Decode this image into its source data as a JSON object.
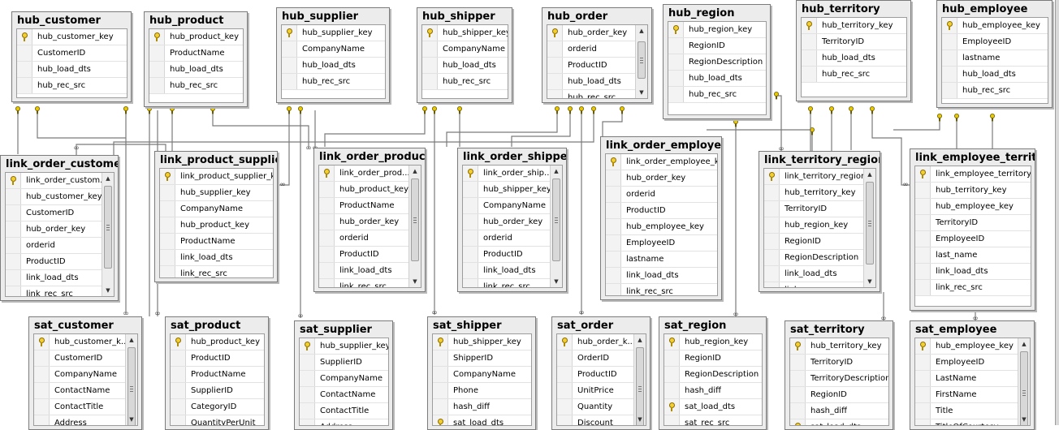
{
  "tables": [
    {
      "id": "hub_customer",
      "title": "hub_customer",
      "key": "hub_customer_key",
      "fields": [
        "CustomerID",
        "hub_load_dts",
        "hub_rec_src"
      ]
    },
    {
      "id": "hub_product",
      "title": "hub_product",
      "key": "hub_product_key",
      "fields": [
        "ProductName",
        "hub_load_dts",
        "hub_rec_src"
      ]
    },
    {
      "id": "hub_supplier",
      "title": "hub_supplier",
      "key": "hub_supplier_key",
      "fields": [
        "CompanyName",
        "hub_load_dts",
        "hub_rec_src"
      ]
    },
    {
      "id": "hub_shipper",
      "title": "hub_shipper",
      "key": "hub_shipper_key",
      "fields": [
        "CompanyName",
        "hub_load_dts",
        "hub_rec_src"
      ]
    },
    {
      "id": "hub_order",
      "title": "hub_order",
      "key": "hub_order_key",
      "fields": [
        "orderid",
        "ProductID",
        "hub_load_dts",
        "hub_rec_src"
      ]
    },
    {
      "id": "hub_region",
      "title": "hub_region",
      "key": "hub_region_key",
      "fields": [
        "RegionID",
        "RegionDescription",
        "hub_load_dts",
        "hub_rec_src"
      ]
    },
    {
      "id": "hub_territory",
      "title": "hub_territory",
      "key": "hub_territory_key",
      "fields": [
        "TerritoryID",
        "hub_load_dts",
        "hub_rec_src"
      ]
    },
    {
      "id": "hub_employee",
      "title": "hub_employee",
      "key": "hub_employee_key",
      "fields": [
        "EmployeeID",
        "lastname",
        "hub_load_dts",
        "hub_rec_src"
      ]
    },
    {
      "id": "link_order_customer",
      "title": "link_order_customer",
      "key": "link_order_custom...",
      "fields": [
        "hub_customer_key",
        "CustomerID",
        "hub_order_key",
        "orderid",
        "ProductID",
        "link_load_dts",
        "link_rec_src"
      ]
    },
    {
      "id": "link_product_supplier",
      "title": "link_product_supplier",
      "key": "link_product_supplier_k...",
      "fields": [
        "hub_supplier_key",
        "CompanyName",
        "hub_product_key",
        "ProductName",
        "link_load_dts",
        "link_rec_src"
      ]
    },
    {
      "id": "link_order_product",
      "title": "link_order_product",
      "key": "link_order_prod...",
      "fields": [
        "hub_product_key",
        "ProductName",
        "hub_order_key",
        "orderid",
        "ProductID",
        "link_load_dts",
        "link_rec_src"
      ]
    },
    {
      "id": "link_order_shipper",
      "title": "link_order_shipper",
      "key": "link_order_ship...",
      "fields": [
        "hub_shipper_key",
        "CompanyName",
        "hub_order_key",
        "orderid",
        "ProductID",
        "link_load_dts",
        "link_rec_src"
      ]
    },
    {
      "id": "link_order_employee",
      "title": "link_order_employee",
      "key": "link_order_employee_key",
      "fields": [
        "hub_order_key",
        "orderid",
        "ProductID",
        "hub_employee_key",
        "EmployeeID",
        "lastname",
        "link_load_dts",
        "link_rec_src"
      ]
    },
    {
      "id": "link_territory_region",
      "title": "link_territory_region",
      "key": "link_territory_region...",
      "fields": [
        "hub_territory_key",
        "TerritoryID",
        "hub_region_key",
        "RegionID",
        "RegionDescription",
        "link_load_dts",
        "link_rec_src"
      ]
    },
    {
      "id": "link_employee_territory",
      "title": "link_employee_territory",
      "key": "link_employee_territory_...",
      "fields": [
        "hub_territory_key",
        "hub_employee_key",
        "TerritoryID",
        "EmployeeID",
        "last_name",
        "link_load_dts",
        "link_rec_src"
      ]
    },
    {
      "id": "sat_customer",
      "title": "sat_customer",
      "key": "hub_customer_k...",
      "fields": [
        "CustomerID",
        "CompanyName",
        "ContactName",
        "ContactTitle",
        "Address"
      ]
    },
    {
      "id": "sat_product",
      "title": "sat_product",
      "key": "hub_product_key",
      "fields": [
        "ProductID",
        "ProductName",
        "SupplierID",
        "CategoryID",
        "QuantityPerUnit"
      ]
    },
    {
      "id": "sat_supplier",
      "title": "sat_supplier",
      "key": "hub_supplier_key",
      "fields": [
        "SupplierID",
        "CompanyName",
        "ContactName",
        "ContactTitle",
        "Address"
      ]
    },
    {
      "id": "sat_shipper",
      "title": "sat_shipper",
      "key": "hub_shipper_key",
      "fields": [
        "ShipperID",
        "CompanyName",
        "Phone",
        "hash_diff",
        "sat_load_dts"
      ],
      "keyed": [
        4
      ]
    },
    {
      "id": "sat_order",
      "title": "sat_order",
      "key": "hub_order_k...",
      "fields": [
        "OrderID",
        "ProductID",
        "UnitPrice",
        "Quantity",
        "Discount"
      ]
    },
    {
      "id": "sat_region",
      "title": "sat_region",
      "key": "hub_region_key",
      "fields": [
        "RegionID",
        "RegionDescription",
        "hash_diff",
        "sat_load_dts",
        "sat_rec_src"
      ],
      "keyed": [
        3
      ]
    },
    {
      "id": "sat_territory",
      "title": "sat_territory",
      "key": "hub_territory_key",
      "fields": [
        "TerritoryID",
        "TerritoryDescription",
        "RegionID",
        "hash_diff",
        "sat_load_dts"
      ],
      "keyed": [
        4
      ]
    },
    {
      "id": "sat_employee",
      "title": "sat_employee",
      "key": "hub_employee_key",
      "fields": [
        "EmployeeID",
        "LastName",
        "FirstName",
        "Title",
        "TitleOfCourtesy"
      ]
    }
  ],
  "colors": {
    "line": "#7a7a7a",
    "key_icon": "#f3d030",
    "connector": "#e8c800"
  }
}
